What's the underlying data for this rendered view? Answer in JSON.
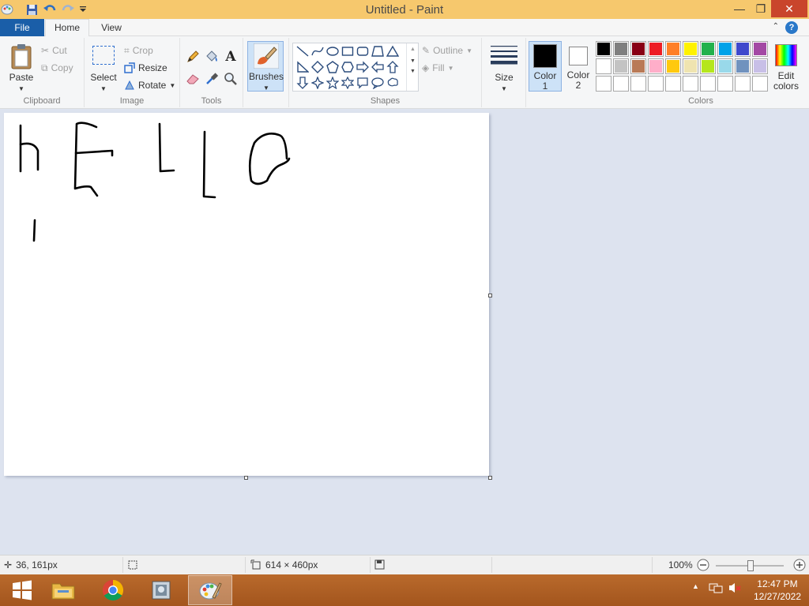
{
  "window": {
    "title": "Untitled - Paint",
    "controls": {
      "minimize": "—",
      "restore": "❐",
      "close": "✕"
    }
  },
  "quick_access": [
    "paint-app-icon",
    "save-icon",
    "undo-icon",
    "redo-icon",
    "customize-dropdown-icon"
  ],
  "tabs": {
    "file": "File",
    "home": "Home",
    "view": "View"
  },
  "ribbon": {
    "clipboard": {
      "paste": "Paste",
      "cut": "Cut",
      "copy": "Copy",
      "group": "Clipboard"
    },
    "image": {
      "select": "Select",
      "crop": "Crop",
      "resize": "Resize",
      "rotate": "Rotate",
      "group": "Image"
    },
    "tools": {
      "group": "Tools",
      "items": [
        "pencil-icon",
        "fill-bucket-icon",
        "text-icon",
        "eraser-icon",
        "color-picker-icon",
        "magnifier-icon"
      ]
    },
    "brushes": {
      "label": "Brushes"
    },
    "shapes": {
      "outline": "Outline",
      "fill": "Fill",
      "group": "Shapes"
    },
    "size": {
      "label": "Size"
    },
    "color1": {
      "line1": "Color",
      "line2": "1",
      "value": "#000000"
    },
    "color2": {
      "line1": "Color",
      "line2": "2",
      "value": "#ffffff"
    },
    "colors": {
      "group": "Colors",
      "row1": [
        "#000000",
        "#7f7f7f",
        "#880015",
        "#ed1c24",
        "#ff7f27",
        "#fff200",
        "#22b14c",
        "#00a2e8",
        "#3f48cc",
        "#a349a4"
      ],
      "row2": [
        "#ffffff",
        "#c3c3c3",
        "#b97a57",
        "#ffaec9",
        "#ffc90e",
        "#efe4b0",
        "#b5e61d",
        "#99d9ea",
        "#7092be",
        "#c8bfe7"
      ],
      "row3": [
        "",
        "",
        "",
        "",
        "",
        "",
        "",
        "",
        "",
        ""
      ]
    },
    "edit_colors": {
      "line1": "Edit",
      "line2": "colors"
    }
  },
  "canvas": {
    "background": "#ffffff",
    "stroke_color": "#000000"
  },
  "status": {
    "cursor_position": "36, 161px",
    "selection_size": "",
    "canvas_size": "614 × 460px",
    "zoom": "100%"
  },
  "taskbar": {
    "apps": [
      "windows-start-icon",
      "file-explorer-icon",
      "chrome-icon",
      "photo-viewer-icon",
      "paint-icon"
    ],
    "clock_time": "12:47 PM",
    "clock_date": "12/27/2022"
  }
}
